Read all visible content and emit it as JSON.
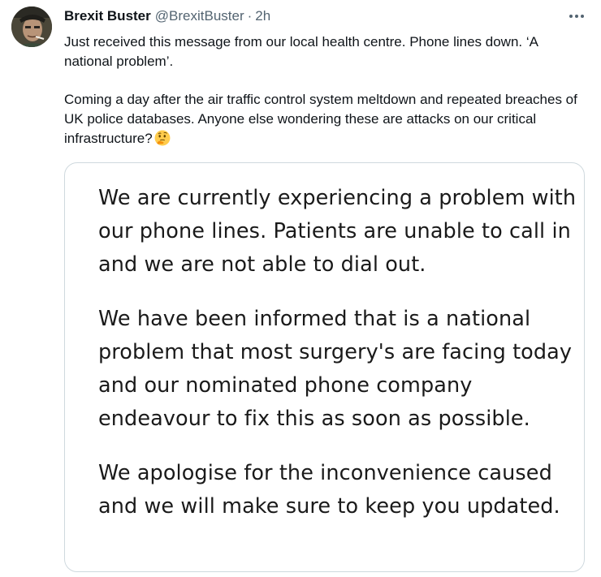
{
  "tweet": {
    "display_name": "Brexit Buster",
    "handle": "@BrexitBuster",
    "separator": "·",
    "time": "2h",
    "more_icon": "more-horizontal-icon",
    "paragraphs": [
      "Just received this message from our local health centre. Phone lines down. ‘A national problem’.",
      "Coming a day after the air traffic control system meltdown and repeated breaches of UK police databases. Anyone else wondering these are attacks on our critical infrastructure?"
    ],
    "emoji": "thinking-face-emoji"
  },
  "media": {
    "paragraphs": [
      "We are currently experiencing a problem with our phone lines. Patients are unable to call in and we are not able to dial out.",
      "We have been informed that is a national problem that most surgery's are facing today and our nominated phone company endeavour to fix this as soon as possible.",
      "We apologise for the inconvenience caused and we will make sure to keep you updated."
    ]
  },
  "colors": {
    "text_primary": "#0f1419",
    "text_secondary": "#536471",
    "card_border": "#cfd9de",
    "background": "#ffffff"
  }
}
